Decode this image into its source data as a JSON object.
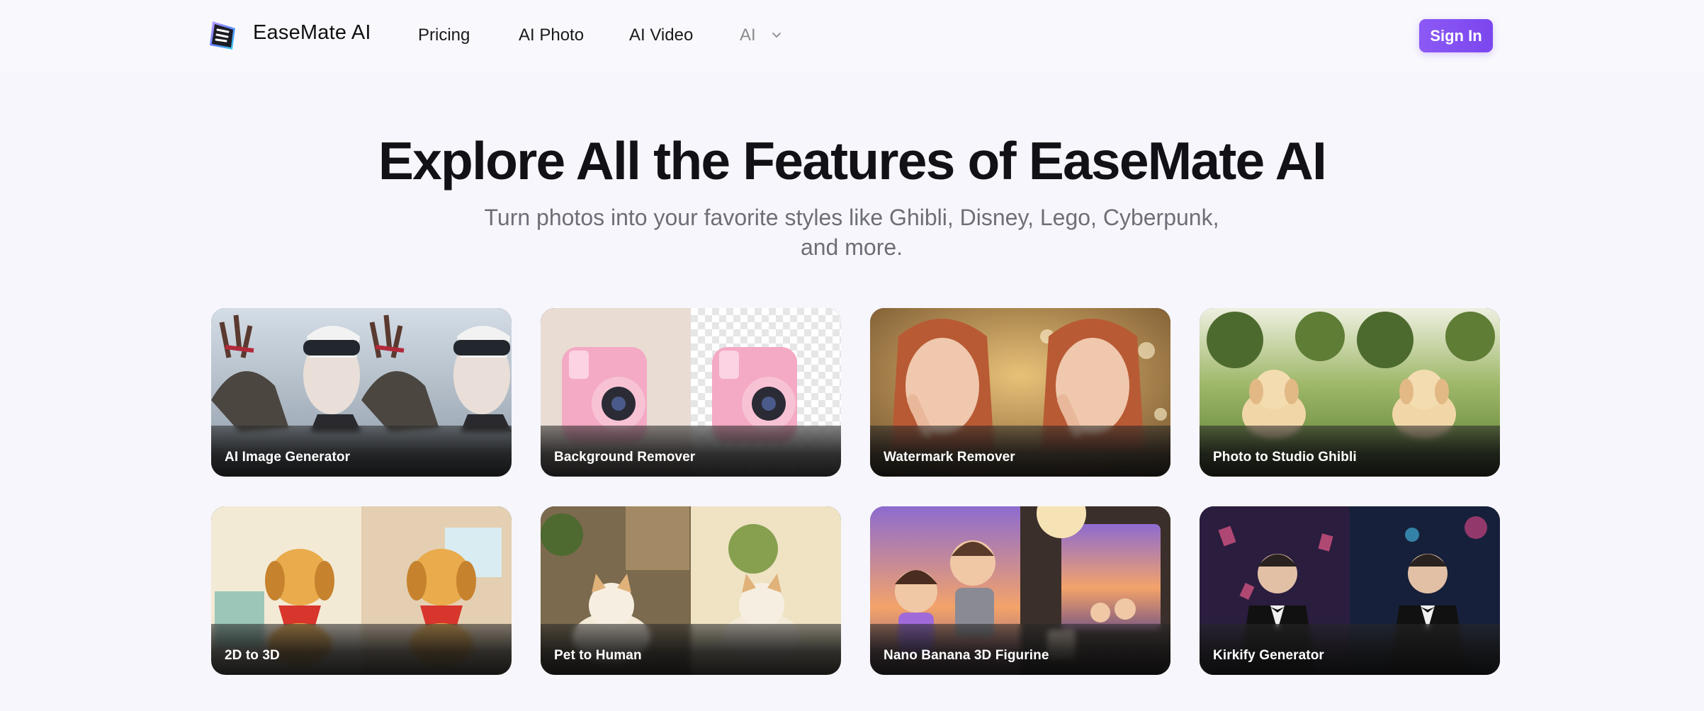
{
  "nav": {
    "brand": "EaseMate AI",
    "links": [
      "Pricing",
      "AI Photo",
      "AI Video"
    ],
    "more_label": "AI",
    "signin_label": "Sign In"
  },
  "hero": {
    "title": "Explore All the Features of EaseMate AI",
    "subtitle_line1": "Turn photos into your favorite styles like Ghibli, Disney, Lego, Cyberpunk,",
    "subtitle_line2": "and more."
  },
  "features": [
    {
      "label": "AI Image Generator"
    },
    {
      "label": "Background Remover"
    },
    {
      "label": "Watermark Remover"
    },
    {
      "label": "Photo to Studio Ghibli"
    },
    {
      "label": "2D to 3D"
    },
    {
      "label": "Pet to Human"
    },
    {
      "label": "Nano Banana 3D Figurine"
    },
    {
      "label": "Kirkify Generator"
    }
  ],
  "theme": {
    "accent": "#8354f2",
    "page_bg": "#f7f6fc"
  }
}
